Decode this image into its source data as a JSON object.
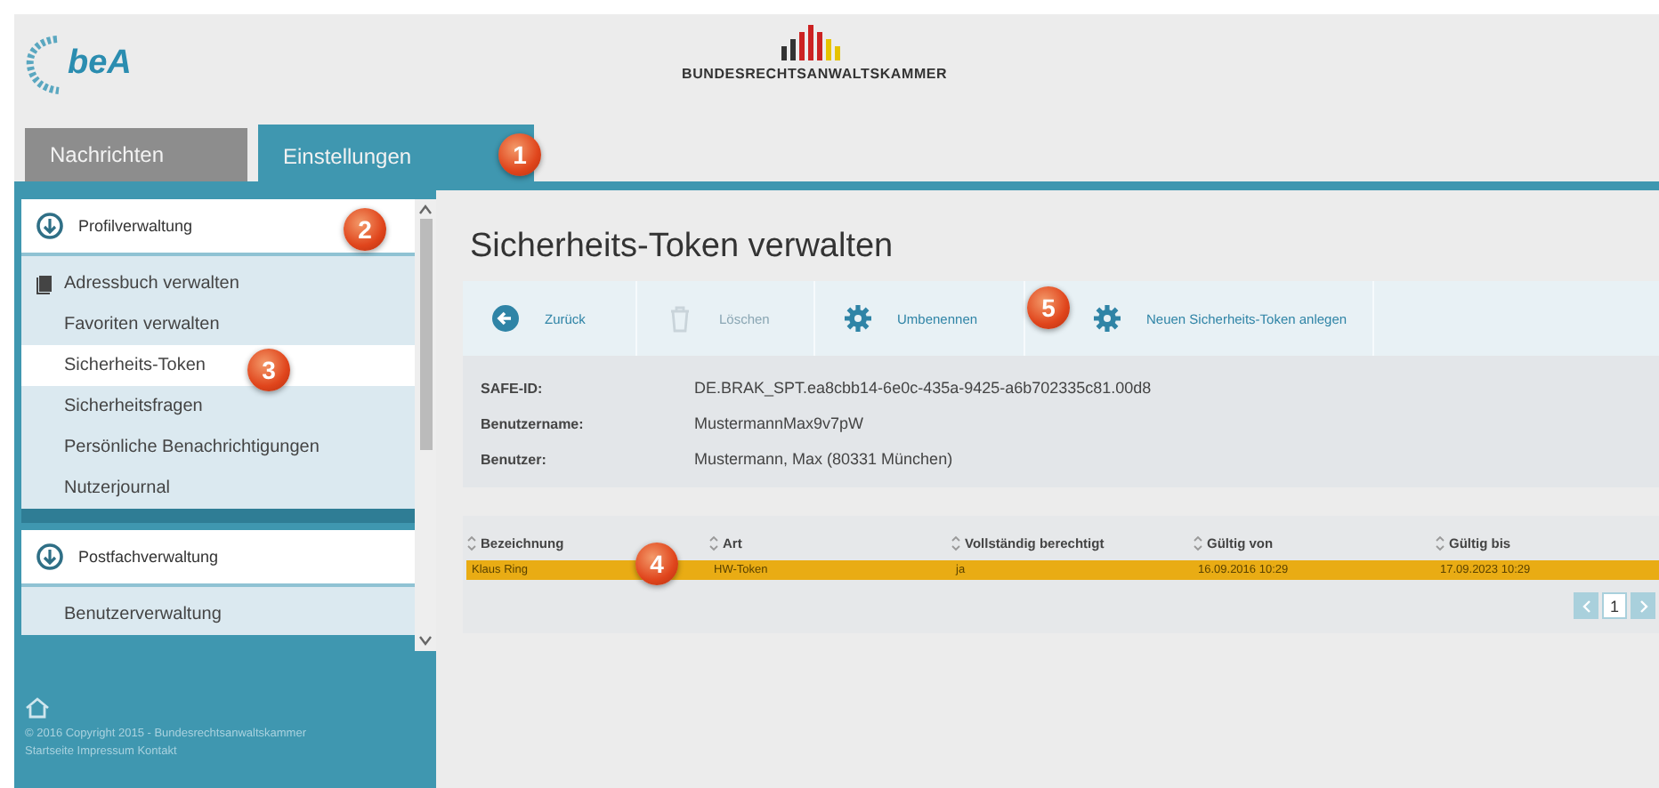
{
  "header": {
    "logo_text": "beA",
    "org_name": "BUNDESRECHTSANWALTSKAMMER"
  },
  "tabs": [
    {
      "label": "Nachrichten",
      "selected": false
    },
    {
      "label": "Einstellungen",
      "selected": true
    }
  ],
  "sidebar": {
    "sections": [
      {
        "title": "Profilverwaltung",
        "expanded": true,
        "items": [
          {
            "label": "Adressbuch verwalten",
            "kind": "book",
            "selected": false
          },
          {
            "label": "Favoriten verwalten",
            "kind": "plain",
            "selected": false
          },
          {
            "label": "Sicherheits-Token",
            "kind": "plain",
            "selected": true
          },
          {
            "label": "Sicherheitsfragen",
            "kind": "plain",
            "selected": false
          },
          {
            "label": "Persönliche Benachrichtigungen",
            "kind": "plain",
            "selected": false
          },
          {
            "label": "Nutzerjournal",
            "kind": "plain",
            "selected": false
          }
        ]
      },
      {
        "title": "Postfachverwaltung",
        "expanded": true,
        "items": [
          {
            "label": "Benutzerverwaltung",
            "kind": "plain",
            "selected": false
          }
        ]
      }
    ],
    "footer": [
      "© 2016 Copyright 2015 - Bundesrechtsanwaltskammer",
      "Startseite Impressum Kontakt"
    ]
  },
  "page_title": "Sicherheits-Token verwalten",
  "toolbar": [
    {
      "label": "Zurück",
      "kind": "back",
      "disabled": false
    },
    {
      "label": "Löschen",
      "kind": "delete",
      "disabled": true
    },
    {
      "label": "Umbenennen",
      "kind": "gear",
      "disabled": false
    },
    {
      "label": "Neuen Sicherheits-Token anlegen",
      "kind": "gear",
      "disabled": false
    }
  ],
  "details": [
    {
      "label": "SAFE-ID:",
      "value": "DE.BRAK_SPT.ea8cbb14-6e0c-435a-9425-a6b702335c81.00d8"
    },
    {
      "label": "Benutzername:",
      "value": "MustermannMax9v7pW"
    },
    {
      "label": "Benutzer:",
      "value": "Mustermann, Max (80331 München)"
    }
  ],
  "table": {
    "columns": [
      "Bezeichnung",
      "Art",
      "Vollständig berechtigt",
      "Gültig von",
      "Gültig bis"
    ],
    "rows": [
      {
        "selected": true,
        "cells": [
          "Klaus Ring",
          "HW-Token",
          "ja",
          "16.09.2016 10:29",
          "17.09.2023 10:29"
        ]
      }
    ]
  },
  "pagination": {
    "pages": [
      {
        "label": "1",
        "selected": true
      }
    ]
  },
  "callouts": [
    "1",
    "2",
    "3",
    "4",
    "5"
  ]
}
